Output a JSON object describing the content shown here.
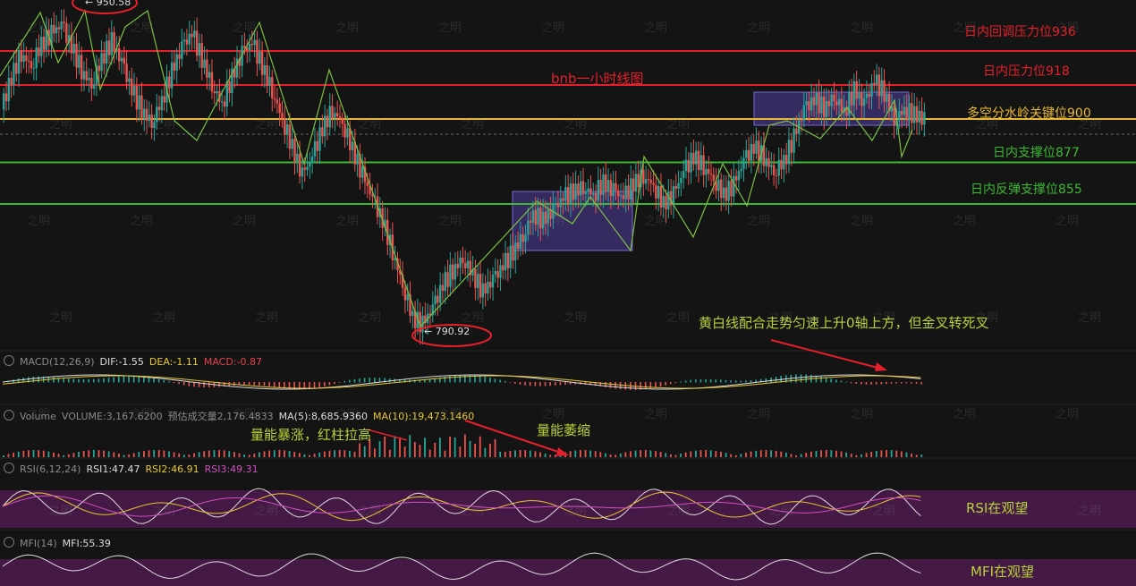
{
  "chart_data": {
    "type": "candlestick",
    "title": "bnb一小时线图",
    "series_approx_close": [
      905,
      922,
      935,
      928,
      940,
      945,
      950,
      938,
      926,
      918,
      932,
      941,
      930,
      915,
      905,
      898,
      910,
      925,
      938,
      945,
      932,
      918,
      908,
      922,
      935,
      940,
      928,
      915,
      900,
      885,
      870,
      880,
      895,
      905,
      898,
      884,
      870,
      858,
      846,
      830,
      812,
      795,
      791,
      800,
      812,
      820,
      826,
      818,
      808,
      815,
      822,
      830,
      838,
      850,
      846,
      852,
      858,
      862,
      864,
      860,
      866,
      862,
      858,
      866,
      870,
      865,
      855,
      860,
      872,
      880,
      875,
      868,
      860,
      865,
      878,
      885,
      880,
      872,
      878,
      890,
      905,
      910,
      906,
      912,
      904,
      915,
      908,
      920,
      914,
      900,
      905,
      902,
      900
    ],
    "price_high_marker": "950.58",
    "price_low_marker": "790.92",
    "levels": [
      {
        "label": "日内回调压力位936",
        "value": 936,
        "color": "#e5202b"
      },
      {
        "label": "日内压力位918",
        "value": 918,
        "color": "#e5202b"
      },
      {
        "label": "多空分水岭关键位900",
        "value": 900,
        "color": "#e8b830"
      },
      {
        "label": "日内支撑位877",
        "value": 877,
        "color": "#3cb832"
      },
      {
        "label": "日内反弹支撑位855",
        "value": 855,
        "color": "#3cb832"
      }
    ],
    "annotations": {
      "macd_note": "黄白线配合走势匀速上升0轴上方，但金叉转死叉",
      "vol_note_1": "量能暴涨，红柱拉高",
      "vol_note_2": "量能萎缩",
      "rsi_note": "RSI在观望",
      "mfi_note": "MFI在观望"
    },
    "indicators": {
      "macd": {
        "name": "MACD(12,26,9)",
        "dif": "DIF:-1.55",
        "dea": "DEA:-1.11",
        "macd": "MACD:-0.87"
      },
      "volume": {
        "name": "Volume",
        "vol": "VOLUME:3,167.6200",
        "pred": "预估成交量2,176.4833",
        "ma5": "MA(5):8,685.9360",
        "ma10": "MA(10):19,473.1460"
      },
      "rsi": {
        "name": "RSI(6,12,24)",
        "rsi1": "RSI1:47.47",
        "rsi2": "RSI2:46.91",
        "rsi3": "RSI3:49.31"
      },
      "mfi": {
        "name": "MFI(14)",
        "mfi": "MFI:55.39"
      }
    }
  },
  "watermark": "之明",
  "colors": {
    "up": "#26a69a",
    "down": "#ef5350",
    "zig": "#7bc043",
    "box": "rgba(95,70,190,0.45)",
    "rsiBand": "rgba(110,30,110,0.55)"
  }
}
